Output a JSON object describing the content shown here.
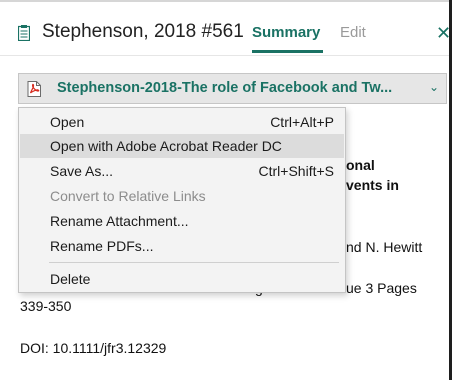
{
  "header": {
    "title": "Stephenson, 2018 #561",
    "tabs": [
      {
        "label": "Summary",
        "active": true
      },
      {
        "label": "Edit",
        "active": false
      }
    ],
    "accent_color": "#1a7264"
  },
  "attachment": {
    "label": "Stephenson-2018-The role of Facebook and Tw...",
    "icon": "pdf-icon"
  },
  "menu": {
    "items": [
      {
        "label": "Open",
        "shortcut": "Ctrl+Alt+P",
        "enabled": true
      },
      {
        "label": "Open with Adobe Acrobat Reader DC",
        "shortcut": "",
        "enabled": true,
        "highlighted": true
      },
      {
        "label": "Save As...",
        "shortcut": "Ctrl+Shift+S",
        "enabled": true
      },
      {
        "label": "Convert to Relative Links",
        "shortcut": "",
        "enabled": false
      },
      {
        "label": "Rename Attachment...",
        "shortcut": "",
        "enabled": true
      },
      {
        "label": "Rename PDFs...",
        "shortcut": "",
        "enabled": true
      },
      {
        "label": "Delete",
        "shortcut": "",
        "enabled": true
      }
    ]
  },
  "reference": {
    "title_line1_fragment": "onal",
    "title_line2_fragment": "vents in",
    "authors_fragment": "nd N. Hewitt",
    "issue_fragment": "ue 3 Pages",
    "issue_left_fragment": "g",
    "pages": "339-350",
    "doi": "DOI: 10.1111/jfr3.12329"
  }
}
